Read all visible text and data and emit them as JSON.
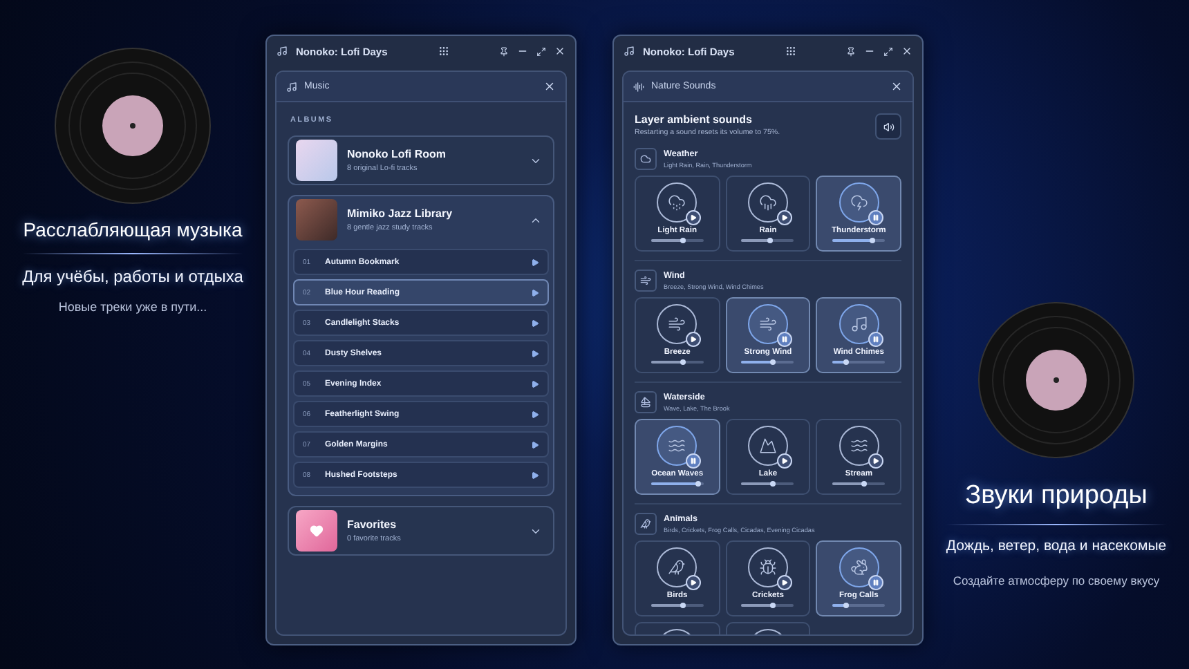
{
  "promo_left": {
    "title": "Расслабляющая музыка",
    "subtitle": "Для учёбы, работы и отдыха",
    "note": "Новые треки уже в пути..."
  },
  "music_window": {
    "title": "Nonoko: Lofi Days",
    "panel_title": "Music",
    "section_label": "ALBUMS",
    "albums": [
      {
        "kind": "album",
        "name": "Nonoko Lofi Room",
        "subtitle": "8 original Lo-fi tracks",
        "expanded": false
      },
      {
        "kind": "album",
        "name": "Mimiko Jazz Library",
        "subtitle": "8 gentle jazz study tracks",
        "expanded": true,
        "tracks": [
          {
            "number": "01",
            "title": "Autumn Bookmark",
            "selected": false
          },
          {
            "number": "02",
            "title": "Blue Hour Reading",
            "selected": true
          },
          {
            "number": "03",
            "title": "Candlelight Stacks",
            "selected": false
          },
          {
            "number": "04",
            "title": "Dusty Shelves",
            "selected": false
          },
          {
            "number": "05",
            "title": "Evening Index",
            "selected": false
          },
          {
            "number": "06",
            "title": "Featherlight Swing",
            "selected": false
          },
          {
            "number": "07",
            "title": "Golden Margins",
            "selected": false
          },
          {
            "number": "08",
            "title": "Hushed Footsteps",
            "selected": false
          }
        ]
      },
      {
        "kind": "favorites",
        "name": "Favorites",
        "subtitle": "0 favorite tracks",
        "expanded": false
      }
    ]
  },
  "nature_window": {
    "title": "Nonoko: Lofi Days",
    "panel_title": "Nature Sounds",
    "heading": "Layer ambient sounds",
    "hint": "Restarting a sound resets its volume to 75%.",
    "categories": [
      {
        "name": "Weather",
        "members": "Light Rain, Rain, Thunderstorm",
        "sounds": [
          {
            "name": "Light Rain",
            "playing": false,
            "level": 0.6
          },
          {
            "name": "Rain",
            "playing": false,
            "level": 0.55
          },
          {
            "name": "Thunderstorm",
            "playing": true,
            "level": 0.75
          }
        ]
      },
      {
        "name": "Wind",
        "members": "Breeze, Strong Wind, Wind Chimes",
        "sounds": [
          {
            "name": "Breeze",
            "playing": false,
            "level": 0.6
          },
          {
            "name": "Strong Wind",
            "playing": true,
            "level": 0.6
          },
          {
            "name": "Wind Chimes",
            "playing": true,
            "level": 0.25
          }
        ]
      },
      {
        "name": "Waterside",
        "members": "Wave, Lake, The Brook",
        "sounds": [
          {
            "name": "Ocean Waves",
            "playing": true,
            "level": 0.9
          },
          {
            "name": "Lake",
            "playing": false,
            "level": 0.6
          },
          {
            "name": "Stream",
            "playing": false,
            "level": 0.6
          }
        ]
      },
      {
        "name": "Animals",
        "members": "Birds, Crickets, Frog Calls, Cicadas, Evening Cicadas",
        "sounds": [
          {
            "name": "Birds",
            "playing": false,
            "level": 0.6
          },
          {
            "name": "Crickets",
            "playing": false,
            "level": 0.6
          },
          {
            "name": "Frog Calls",
            "playing": true,
            "level": 0.25
          },
          {
            "playing": false
          },
          {
            "playing": false
          }
        ]
      }
    ]
  },
  "promo_right": {
    "title": "Звуки природы",
    "subtitle": "Дождь, ветер, вода и насекомые",
    "note": "Создайте атмосферу по своему вкусу"
  }
}
